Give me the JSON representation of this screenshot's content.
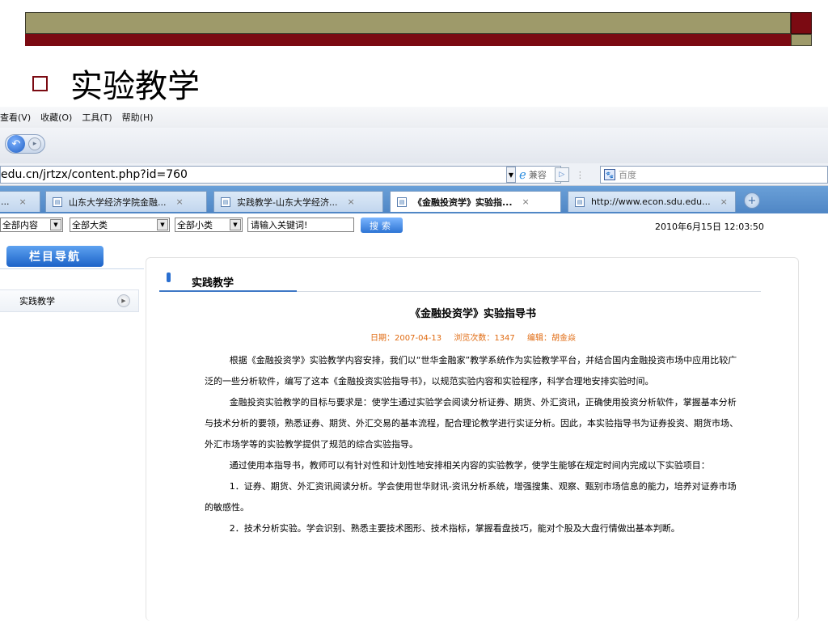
{
  "slide": {
    "title": "实验教学"
  },
  "browser": {
    "menu": [
      "查看(V)",
      "收藏(O)",
      "工具(T)",
      "帮助(H)"
    ],
    "address": "edu.cn/jrtzx/content.php?id=760",
    "compat_label": "兼容",
    "search_placeholder": "百度",
    "tabs": [
      {
        "label": "...",
        "close": "×"
      },
      {
        "label": "山东大学经济学院金融...",
        "close": "×"
      },
      {
        "label": "实践教学-山东大学经济...",
        "close": "×"
      },
      {
        "label": "《金融投资学》实验指...",
        "close": "×"
      },
      {
        "label": "http://www.econ.sdu.edu...",
        "close": "×"
      }
    ]
  },
  "filters": {
    "content_select": "全部内容",
    "category_select": "全部大类",
    "subcategory_select": "全部小类",
    "keyword_value": "请输入关键词!",
    "search_label": "搜索",
    "datetime": "2010年6月15日 12:03:50"
  },
  "sidebar": {
    "header": "栏目导航",
    "items": [
      {
        "label": "实践教学"
      }
    ]
  },
  "main": {
    "section_title": "实践教学",
    "article_title": "《金融投资学》实验指导书",
    "meta": {
      "date": "日期：2007-04-13",
      "views": "浏览次数：1347",
      "editor": "编辑：胡金焱"
    },
    "paragraphs": [
      "根据《金融投资学》实验教学内容安排，我们以“世华金融家”教学系统作为实验教学平台，并结合国内金融投资市场中应用比较广泛的一些分析软件，编写了这本《金融投资实验指导书》，以规范实验内容和实验程序，科学合理地安排实验时间。",
      "金融投资实验教学的目标与要求是：使学生通过实验学会阅读分析证券、期货、外汇资讯，正确使用投资分析软件，掌握基本分析与技术分析的要领，熟悉证券、期货、外汇交易的基本流程，配合理论教学进行实证分析。因此，本实验指导书为证券投资、期货市场、外汇市场学等的实验教学提供了规范的综合实验指导。",
      "通过使用本指导书，教师可以有针对性和计划性地安排相关内容的实验教学，使学生能够在规定时间内完成以下实验项目：",
      "1．证券、期货、外汇资讯阅读分析。学会使用世华财讯-资讯分析系统，增强搜集、观察、甄别市场信息的能力，培养对证券市场的敏感性。",
      "2．技术分析实验。学会识别、熟悉主要技术图形、技术指标，掌握看盘技巧，能对个股及大盘行情做出基本判断。"
    ]
  },
  "colors": {
    "olive": "#9e9a6a",
    "maroon": "#7b0a12",
    "meta_orange": "#e06a10",
    "accent_blue": "#2a6fd0"
  }
}
